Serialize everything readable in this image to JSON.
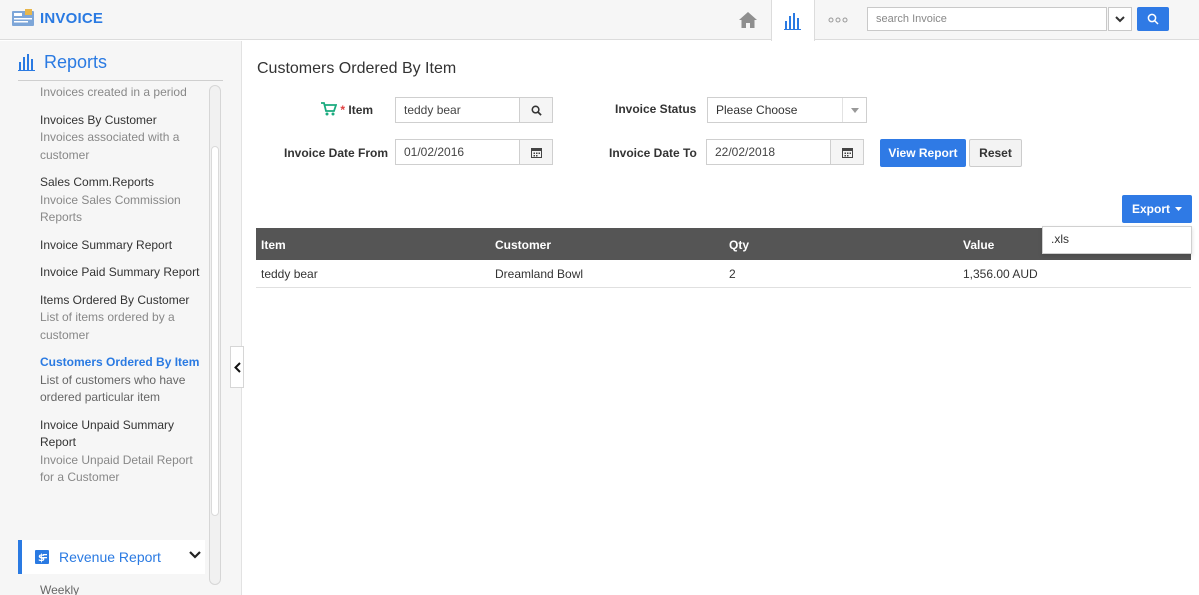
{
  "app": {
    "title": "INVOICE"
  },
  "topbar": {
    "search_placeholder": "search Invoice"
  },
  "sidebar": {
    "title": "Reports",
    "items": [
      {
        "title": "",
        "desc": "Invoices created in a period"
      },
      {
        "title": "Invoices By Customer",
        "desc": "Invoices associated with a customer"
      },
      {
        "title": "Sales Comm.Reports",
        "desc": "Invoice Sales Commission Reports"
      },
      {
        "title": "Invoice Summary Report",
        "desc": ""
      },
      {
        "title": "Invoice Paid Summary Report",
        "desc": ""
      },
      {
        "title": "Items Ordered By Customer",
        "desc": "List of items ordered by a customer"
      },
      {
        "title": "Customers Ordered By Item",
        "desc": "List of customers who have ordered particular item"
      },
      {
        "title": "Invoice Unpaid Summary Report",
        "desc": "Invoice Unpaid Detail Report for a Customer"
      }
    ],
    "active_index": 6,
    "revenue_label": "Revenue Report",
    "weekly_label": "Weekly"
  },
  "main": {
    "title": "Customers Ordered By Item",
    "filters": {
      "item_label": "Item",
      "item_value": "teddy bear",
      "status_label": "Invoice Status",
      "status_value": "Please Choose",
      "date_from_label": "Invoice Date From",
      "date_from_value": "01/02/2016",
      "date_to_label": "Invoice Date To",
      "date_to_value": "22/02/2018",
      "required_mark": "*"
    },
    "buttons": {
      "view_report": "View Report",
      "reset": "Reset",
      "export": "Export"
    },
    "export_menu": [
      ".xls"
    ],
    "table": {
      "columns": [
        "Item",
        "Customer",
        "Qty",
        "Value"
      ],
      "rows": [
        [
          "teddy bear",
          "Dreamland Bowl",
          "2",
          "1,356.00 AUD"
        ]
      ]
    }
  },
  "colors": {
    "accent": "#2a7ae2",
    "primary_button": "#2f7ae5",
    "table_header": "#555555",
    "cart_icon": "#1aab7f"
  }
}
